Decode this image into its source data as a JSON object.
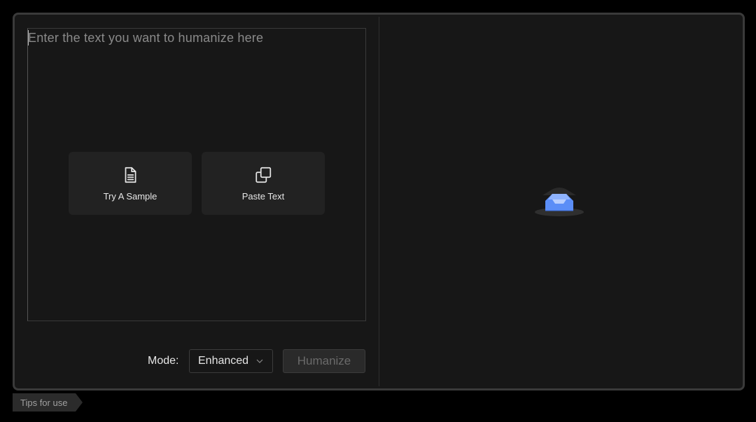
{
  "editor": {
    "placeholder": "Enter the text you want to humanize here"
  },
  "actions": [
    {
      "label": "Try A Sample",
      "icon": "document-icon"
    },
    {
      "label": "Paste Text",
      "icon": "copy-icon"
    }
  ],
  "controls": {
    "mode_label": "Mode:",
    "mode_value": "Enhanced",
    "humanize_label": "Humanize"
  },
  "output": {
    "empty_icon": "empty-inbox-icon"
  },
  "footer": {
    "tips_label": "Tips for use"
  },
  "colors": {
    "background": "#000000",
    "panel": "#171717",
    "card": "#222222",
    "accent_blue": "#5b8ef7"
  }
}
